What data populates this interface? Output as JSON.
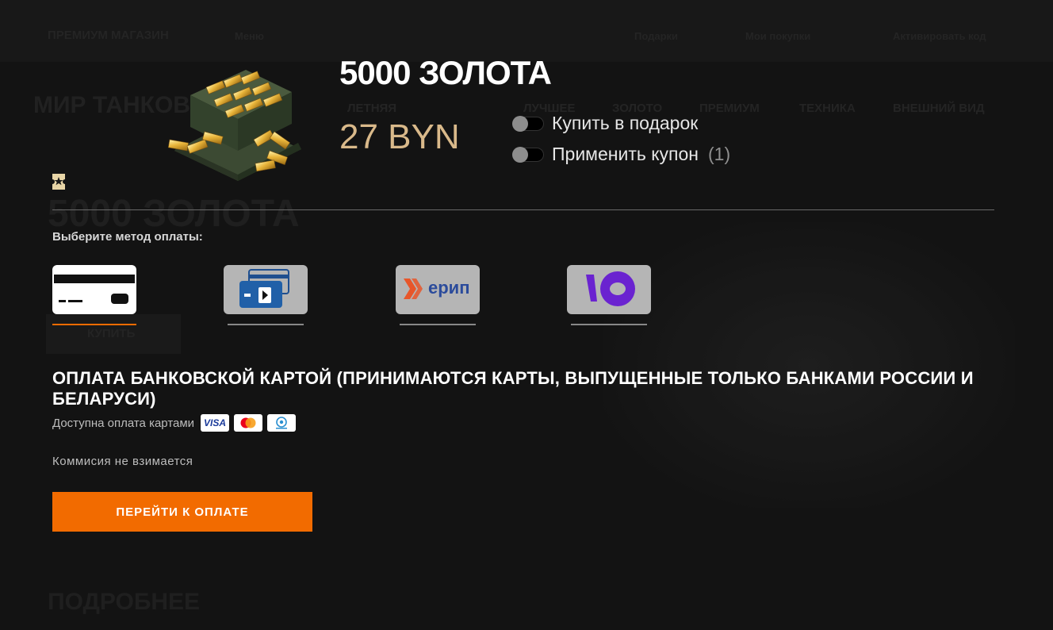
{
  "background": {
    "topbar": {
      "premium_shop": "ПРЕМИУМ МАГАЗИН",
      "menu": "Меню",
      "link_1": "Подарки",
      "link_2": "Мои покупки",
      "link_3": "Активировать код"
    },
    "logo": "МИР ТАНКОВ",
    "nav": [
      "ЛЕТНЯЯ",
      "ЛУЧШЕЕ",
      "ЗОЛОТО",
      "ПРЕМИУМ",
      "ТЕХНИКА",
      "ВНЕШНИЙ ВИД"
    ],
    "product_title": "5000 ЗОЛОТА",
    "buy_button": "КУПИТЬ",
    "more": "ПОДРОБНЕЕ"
  },
  "product": {
    "title": "5000 ЗОЛОТА",
    "price": "27 BYN"
  },
  "options": {
    "gift_label": "Купить в подарок",
    "coupon_label": "Применить купон",
    "coupon_count": "(1)"
  },
  "payment": {
    "prompt": "Выберите метод оплаты:",
    "methods": [
      {
        "name": "bank-card",
        "selected": true
      },
      {
        "name": "e-wallet-card",
        "selected": false
      },
      {
        "name": "erip",
        "label": "ерип",
        "selected": false
      },
      {
        "name": "yoomoney",
        "selected": false
      }
    ],
    "section_title": "ОПЛАТА БАНКОВСКОЙ КАРТОЙ (ПРИНИМАЮТСЯ КАРТЫ, ВЫПУЩЕННЫЕ ТОЛЬКО БАНКАМИ РОССИИ И БЕЛАРУСИ)",
    "cards_label": "Доступна оплата картами",
    "card_brands": [
      "VISA",
      "Mastercard",
      "Belkart"
    ],
    "commission": "Коммисия не взимается",
    "pay_button": "ПЕРЕЙТИ К ОПЛАТЕ"
  },
  "colors": {
    "accent": "#f26b00",
    "price": "#d9b98a",
    "erip_blue": "#2b4b9b",
    "erip_orange": "#e8562a",
    "yoomoney_purple": "#6a23d0"
  }
}
